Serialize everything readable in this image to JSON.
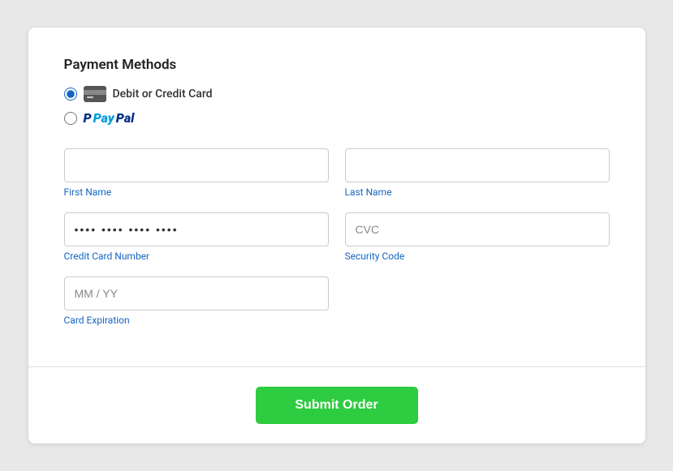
{
  "title": "Payment Methods",
  "payment_options": [
    {
      "id": "debit-credit",
      "label": "Debit or Credit Card",
      "checked": true,
      "icon": "credit-card-icon"
    },
    {
      "id": "paypal",
      "label": "PayPal",
      "checked": false,
      "icon": "paypal-icon"
    }
  ],
  "form": {
    "rows": [
      {
        "fields": [
          {
            "name": "first-name",
            "label": "First Name",
            "placeholder": "",
            "value": "",
            "type": "text"
          },
          {
            "name": "last-name",
            "label": "Last Name",
            "placeholder": "",
            "value": "",
            "type": "text"
          }
        ]
      },
      {
        "fields": [
          {
            "name": "credit-card-number",
            "label": "Credit Card Number",
            "placeholder": "•••• •••• •••• ••••",
            "value": "•••• •••• •••• ••••",
            "type": "text"
          },
          {
            "name": "security-code",
            "label": "Security Code",
            "placeholder": "CVC",
            "value": "",
            "type": "text"
          }
        ]
      },
      {
        "fields": [
          {
            "name": "card-expiration",
            "label": "Card Expiration",
            "placeholder": "MM / YY",
            "value": "",
            "type": "text"
          }
        ]
      }
    ]
  },
  "submit_button": {
    "label": "Submit Order"
  },
  "colors": {
    "accent": "#1565c0",
    "submit_bg": "#2ecc40",
    "paypal_blue": "#003087",
    "paypal_light": "#009cde"
  }
}
